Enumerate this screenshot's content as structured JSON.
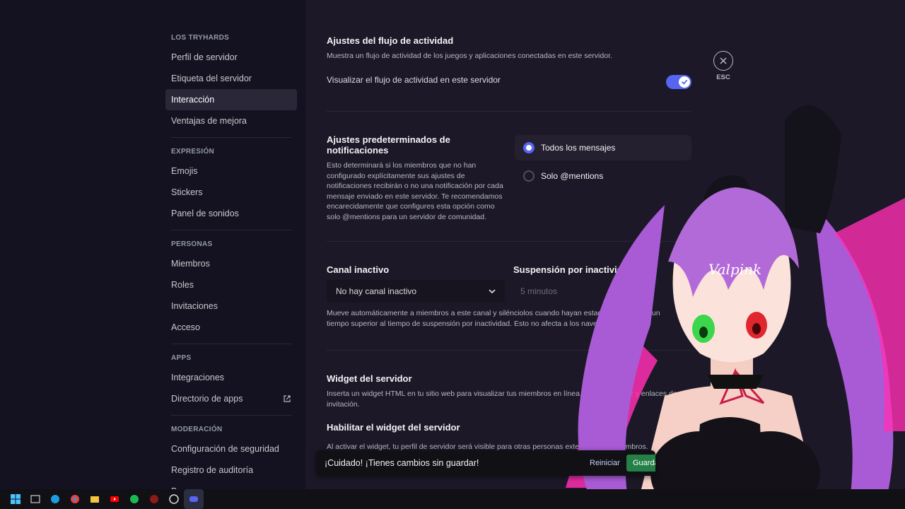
{
  "sidebar": {
    "sections": [
      {
        "header": "LOS TRYHARDS",
        "items": [
          {
            "label": "Perfil de servidor"
          },
          {
            "label": "Etiqueta del servidor"
          },
          {
            "label": "Interacción",
            "active": true
          },
          {
            "label": "Ventajas de mejora"
          }
        ]
      },
      {
        "header": "EXPRESIÓN",
        "items": [
          {
            "label": "Emojis"
          },
          {
            "label": "Stickers"
          },
          {
            "label": "Panel de sonidos"
          }
        ]
      },
      {
        "header": "PERSONAS",
        "items": [
          {
            "label": "Miembros"
          },
          {
            "label": "Roles"
          },
          {
            "label": "Invitaciones"
          },
          {
            "label": "Acceso"
          }
        ]
      },
      {
        "header": "APPS",
        "items": [
          {
            "label": "Integraciones"
          },
          {
            "label": "Directorio de apps",
            "icon": "external-link-icon"
          }
        ]
      },
      {
        "header": "MODERACIÓN",
        "items": [
          {
            "label": "Configuración de seguridad"
          },
          {
            "label": "Registro de auditoría"
          },
          {
            "label": "Baneos"
          }
        ]
      }
    ]
  },
  "activity": {
    "title": "Ajustes del flujo de actividad",
    "desc": "Muestra un flujo de actividad de los juegos y aplicaciones conectadas en este servidor.",
    "toggle_label": "Visualizar el flujo de actividad en este servidor",
    "toggle_on": true
  },
  "notifications": {
    "title": "Ajustes predeterminados de notificaciones",
    "desc": "Esto determinará si los miembros que no han configurado explícitamente sus ajustes de notificaciones recibirán o no una notificación por cada mensaje enviado en este servidor. Te recomendamos encarecidamente que configures esta opción como solo @mentions para un servidor de comunidad.",
    "options": [
      {
        "label": "Todos los mensajes",
        "selected": true
      },
      {
        "label": "Solo @mentions",
        "selected": false
      }
    ]
  },
  "inactive": {
    "channel_title": "Canal inactivo",
    "channel_value": "No hay canal inactivo",
    "timeout_title": "Suspensión por inactividad",
    "timeout_value": "5 minutos",
    "desc": "Mueve automáticamente a miembros a este canal y silénciolos cuando hayan estado inactivos por un tiempo superior al tiempo de suspensión por inactividad. Esto no afecta a los navegadores."
  },
  "widget": {
    "title": "Widget del servidor",
    "desc": "Inserta un widget HTML en tu sitio web para visualizar tus miembros en línea, canales de voz y enlaces de invitación.",
    "enable_title": "Habilitar el widget del servidor",
    "enable_desc": "Al activar el widget, tu perfil de servidor será visible para otras personas externas a los miembros."
  },
  "unsaved": {
    "message": "¡Cuidado! ¡Tienes cambios sin guardar!",
    "reset": "Reiniciar",
    "save": "Guardar cambios"
  },
  "esc": {
    "label": "ESC"
  },
  "overlay": {
    "watermark": "Valpink"
  },
  "colors": {
    "accent": "#5865f2",
    "save": "#248046",
    "hair": "#b36ad9",
    "hair_pink": "#ff2fb4"
  }
}
